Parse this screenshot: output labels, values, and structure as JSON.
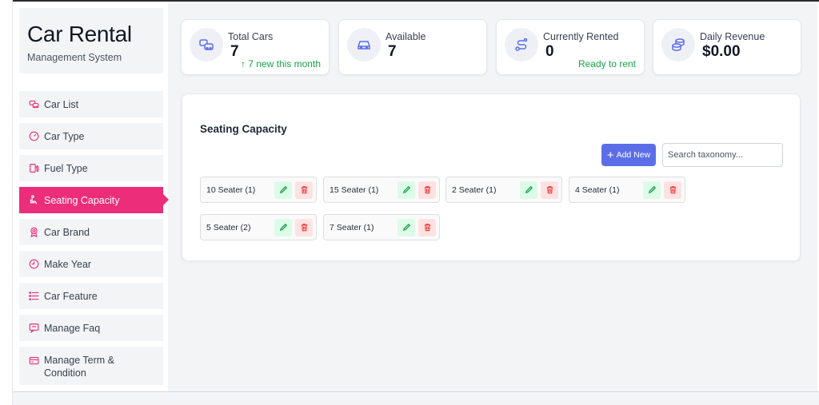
{
  "brand": {
    "title": "Car Rental",
    "subtitle": "Management System"
  },
  "sidebar": {
    "items": [
      {
        "label": "Car List",
        "icon": "cars-icon",
        "active": false
      },
      {
        "label": "Car Type",
        "icon": "gauge-icon",
        "active": false
      },
      {
        "label": "Fuel Type",
        "icon": "fuel-icon",
        "active": false
      },
      {
        "label": "Seating Capacity",
        "icon": "seat-icon",
        "active": true
      },
      {
        "label": "Car Brand",
        "icon": "brand-icon",
        "active": false
      },
      {
        "label": "Make Year",
        "icon": "clock-icon",
        "active": false
      },
      {
        "label": "Car Feature",
        "icon": "list-icon",
        "active": false
      },
      {
        "label": "Manage Faq",
        "icon": "faq-icon",
        "active": false
      },
      {
        "label": "Manage Term & Condition",
        "icon": "card-icon",
        "active": false
      }
    ]
  },
  "stats": [
    {
      "label": "Total Cars",
      "value": "7",
      "sub": "↑ 7 new this month",
      "icon": "cars-icon"
    },
    {
      "label": "Available",
      "value": "7",
      "sub": "",
      "icon": "car-icon"
    },
    {
      "label": "Currently Rented",
      "value": "0",
      "sub": "Ready to rent",
      "icon": "route-icon"
    },
    {
      "label": "Daily Revenue",
      "value": "$0.00",
      "sub": "",
      "icon": "coins-icon"
    }
  ],
  "panel": {
    "title": "Seating Capacity",
    "add_label": "Add New",
    "search_placeholder": "Search taxonomy...",
    "chips": [
      {
        "label": "10 Seater (1)"
      },
      {
        "label": "15 Seater (1)"
      },
      {
        "label": "2 Seater (1)"
      },
      {
        "label": "4 Seater (1)"
      },
      {
        "label": "5 Seater (2)"
      },
      {
        "label": "7 Seater (1)"
      }
    ]
  },
  "colors": {
    "accent": "#ec2d79",
    "primary_button": "#5b6ee8",
    "success_text": "#16a34a",
    "edit_bg": "#dcfce7",
    "delete_bg": "#fee2e2"
  }
}
